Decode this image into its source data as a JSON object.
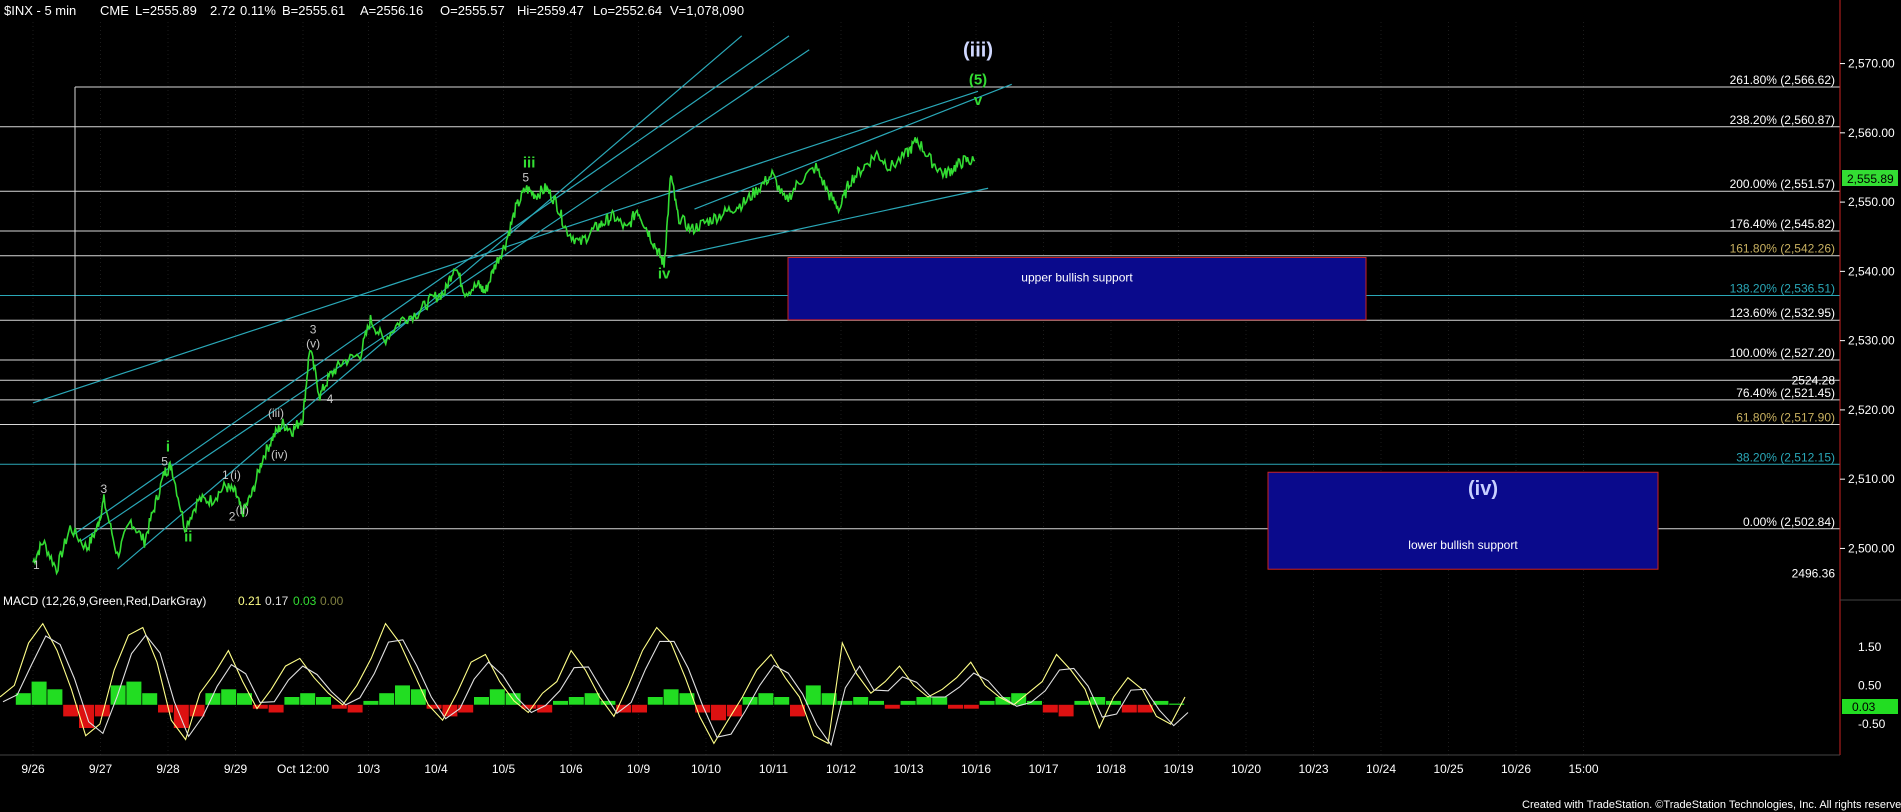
{
  "header": {
    "symbol": "$INX - 5 min",
    "exchange": "CME",
    "last": "L=2555.89",
    "change": "2.72",
    "change_pct": "0.11%",
    "bid": "B=2555.61",
    "ask": "A=2556.16",
    "open": "O=2555.57",
    "high": "Hi=2559.47",
    "low": "Lo=2552.64",
    "volume": "V=1,078,090"
  },
  "macd_header": {
    "label": "MACD (12,26,9,Green,Red,DarkGray)",
    "v1": "0.21",
    "v2": "0.17",
    "v3": "0.03",
    "v4": "0.00"
  },
  "footer": "Created with TradeStation. ©TradeStation Technologies, Inc. All rights reserved.",
  "price_axis_labels": [
    "2,570.00",
    "2,560.00",
    "2,550.00",
    "2,540.00",
    "2,530.00",
    "2,520.00",
    "2,510.00",
    "2,500.00"
  ],
  "current_price_label": "2,555.89",
  "macd_axis_labels": [
    "1.50",
    "0.50",
    "-0.50"
  ],
  "macd_current_label": "0.03",
  "colors": {
    "price": "#33dd33",
    "channel": "#2aa8b8",
    "fib_line": "#d8d8d8",
    "zone_fill": "#0a0a8c",
    "zone_border": "#cc2222",
    "macd_pos": "#22dd22",
    "macd_neg": "#dd1111",
    "macd_line": "#ffff88",
    "macd_signal": "#e0e0e0"
  },
  "chart_data": {
    "type": "line",
    "title": "$INX - 5 min",
    "x_tick_labels": [
      "9/26",
      "9/27",
      "9/28",
      "9/29",
      "Oct 12:00",
      "10/3",
      "10/4",
      "10/5",
      "10/6",
      "10/9",
      "10/10",
      "10/11",
      "10/12",
      "10/13",
      "10/16",
      "10/17",
      "10/18",
      "10/19",
      "10/20",
      "10/23",
      "10/24",
      "10/25",
      "10/26",
      "15:00"
    ],
    "ylim": [
      2494,
      2576
    ],
    "y_ticks": [
      2500,
      2510,
      2520,
      2530,
      2540,
      2550,
      2560,
      2570
    ],
    "series": [
      {
        "values": [
          [
            0,
            2498
          ],
          [
            0.15,
            2501
          ],
          [
            0.35,
            2497
          ],
          [
            0.55,
            2503
          ],
          [
            0.8,
            2500
          ],
          [
            0.95,
            2503
          ],
          [
            1.05,
            2507
          ],
          [
            1.25,
            2499
          ],
          [
            1.45,
            2504
          ],
          [
            1.65,
            2501
          ],
          [
            1.8,
            2506
          ],
          [
            1.95,
            2511
          ],
          [
            2.05,
            2512
          ],
          [
            2.25,
            2503
          ],
          [
            2.45,
            2507
          ],
          [
            2.65,
            2507
          ],
          [
            2.85,
            2509
          ],
          [
            3.0,
            2508
          ],
          [
            3.1,
            2505
          ],
          [
            3.25,
            2508
          ],
          [
            3.4,
            2513
          ],
          [
            3.55,
            2516
          ],
          [
            3.7,
            2518
          ],
          [
            3.85,
            2517
          ],
          [
            4.0,
            2519
          ],
          [
            4.1,
            2529
          ],
          [
            4.25,
            2522
          ],
          [
            4.4,
            2525
          ],
          [
            4.6,
            2527
          ],
          [
            4.85,
            2528
          ],
          [
            5.0,
            2533
          ],
          [
            5.2,
            2530
          ],
          [
            5.45,
            2533
          ],
          [
            5.7,
            2534
          ],
          [
            5.9,
            2536
          ],
          [
            6.1,
            2537
          ],
          [
            6.25,
            2541
          ],
          [
            6.4,
            2537
          ],
          [
            6.6,
            2538
          ],
          [
            6.7,
            2537
          ],
          [
            6.85,
            2541
          ],
          [
            7.0,
            2544
          ],
          [
            7.15,
            2549
          ],
          [
            7.3,
            2552
          ],
          [
            7.45,
            2551
          ],
          [
            7.6,
            2552
          ],
          [
            7.75,
            2550
          ],
          [
            7.9,
            2546
          ],
          [
            8.1,
            2544
          ],
          [
            8.3,
            2546
          ],
          [
            8.45,
            2547
          ],
          [
            8.6,
            2548
          ],
          [
            8.8,
            2546
          ],
          [
            8.95,
            2549
          ],
          [
            9.1,
            2546
          ],
          [
            9.25,
            2543
          ],
          [
            9.35,
            2541
          ],
          [
            9.45,
            2554
          ],
          [
            9.55,
            2548
          ],
          [
            9.75,
            2546
          ],
          [
            9.95,
            2547
          ],
          [
            10.15,
            2548
          ],
          [
            10.35,
            2549
          ],
          [
            10.55,
            2550
          ],
          [
            10.75,
            2552
          ],
          [
            10.95,
            2554
          ],
          [
            11.15,
            2550
          ],
          [
            11.35,
            2553
          ],
          [
            11.6,
            2555
          ],
          [
            11.8,
            2551
          ],
          [
            11.95,
            2549
          ],
          [
            12.1,
            2553
          ],
          [
            12.3,
            2555
          ],
          [
            12.5,
            2557
          ],
          [
            12.7,
            2555
          ],
          [
            12.95,
            2557
          ],
          [
            13.1,
            2559
          ],
          [
            13.3,
            2556
          ],
          [
            13.5,
            2554
          ],
          [
            13.65,
            2555
          ],
          [
            13.8,
            2556
          ],
          [
            13.95,
            2555.9
          ]
        ]
      }
    ],
    "fib_levels": [
      {
        "label": "261.80% (2,566.62)",
        "value": 2566.62,
        "color": "#ffffff"
      },
      {
        "label": "238.20% (2,560.87)",
        "value": 2560.87,
        "color": "#ffffff"
      },
      {
        "label": "200.00% (2,551.57)",
        "value": 2551.57,
        "color": "#ffffff"
      },
      {
        "label": "176.40% (2,545.82)",
        "value": 2545.82,
        "color": "#ffffff"
      },
      {
        "label": "161.80% (2,542.26)",
        "value": 2542.26,
        "color": "#c8b060"
      },
      {
        "label": "138.20% (2,536.51)",
        "value": 2536.51,
        "color": "#2aa8b8"
      },
      {
        "label": "123.60% (2,532.95)",
        "value": 2532.95,
        "color": "#ffffff"
      },
      {
        "label": "100.00% (2,527.20)",
        "value": 2527.2,
        "color": "#ffffff"
      },
      {
        "label": "76.40% (2,521.45)",
        "value": 2521.45,
        "color": "#ffffff"
      },
      {
        "label": "61.80% (2,517.90)",
        "value": 2517.9,
        "color": "#c8b060"
      },
      {
        "label": "38.20% (2,512.15)",
        "value": 2512.15,
        "color": "#2aa8b8"
      },
      {
        "label": "0.00% (2,502.84)",
        "value": 2502.84,
        "color": "#ffffff"
      }
    ],
    "extra_levels": [
      {
        "label": "2524.28",
        "value": 2524.28
      },
      {
        "label": "2496.36",
        "value": 2496.36
      }
    ],
    "zones": [
      {
        "label": "upper bullish support",
        "x0": 9.25,
        "x1": 13.95,
        "y0": 2533,
        "y1": 2542
      },
      {
        "label": "lower bullish support",
        "x0": 13.95,
        "x1": 14.9,
        "y0": 2497,
        "y1": 2511
      },
      {
        "label": "(iv)",
        "x0": 13.95,
        "x1": 14.9,
        "y0": 2505,
        "y1": 2511
      }
    ],
    "wave_labels": [
      {
        "text": "1",
        "x": 0.05,
        "y": 2497,
        "style": "grey"
      },
      {
        "text": "3",
        "x": 1.05,
        "y": 2508,
        "style": "grey"
      },
      {
        "text": "5",
        "x": 1.95,
        "y": 2512,
        "style": "grey"
      },
      {
        "text": "i",
        "x": 2.0,
        "y": 2514,
        "style": "green"
      },
      {
        "text": "ii",
        "x": 2.3,
        "y": 2501,
        "style": "green"
      },
      {
        "text": "1",
        "x": 2.85,
        "y": 2510,
        "style": "grey"
      },
      {
        "text": "(i)",
        "x": 3.0,
        "y": 2510,
        "style": "grey"
      },
      {
        "text": "2",
        "x": 2.95,
        "y": 2504,
        "style": "grey"
      },
      {
        "text": "(ii)",
        "x": 3.1,
        "y": 2505,
        "style": "grey"
      },
      {
        "text": "(iii)",
        "x": 3.6,
        "y": 2519,
        "style": "grey"
      },
      {
        "text": "(iv)",
        "x": 3.65,
        "y": 2513,
        "style": "grey"
      },
      {
        "text": "3",
        "x": 4.15,
        "y": 2531,
        "style": "grey"
      },
      {
        "text": "(v)",
        "x": 4.15,
        "y": 2529,
        "style": "grey"
      },
      {
        "text": "4",
        "x": 4.4,
        "y": 2521,
        "style": "grey"
      },
      {
        "text": "5",
        "x": 7.3,
        "y": 2553,
        "style": "grey"
      },
      {
        "text": "iii",
        "x": 7.35,
        "y": 2555,
        "style": "green"
      },
      {
        "text": "iv",
        "x": 9.35,
        "y": 2539,
        "style": "green"
      },
      {
        "text": "v",
        "x": 14.0,
        "y": 2564,
        "style": "green"
      },
      {
        "text": "(5)",
        "x": 14.0,
        "y": 2567,
        "style": "green"
      },
      {
        "text": "(iii)",
        "x": 14.0,
        "y": 2571,
        "style": "big"
      }
    ],
    "trend_lines": [
      [
        [
          0.0,
          2521
        ],
        [
          14.0,
          2566
        ]
      ],
      [
        [
          0.6,
          2502
        ],
        [
          11.2,
          2574
        ]
      ],
      [
        [
          0.7,
          2501
        ],
        [
          11.5,
          2572
        ]
      ],
      [
        [
          1.25,
          2497
        ],
        [
          10.5,
          2574
        ]
      ],
      [
        [
          9.4,
          2542
        ],
        [
          14.15,
          2552
        ]
      ],
      [
        [
          9.8,
          2549
        ],
        [
          14.5,
          2567
        ]
      ]
    ],
    "macd": {
      "label": "MACD (12,26,9,Green,Red,DarkGray)",
      "ylim": [
        -1.3,
        2.4
      ],
      "y_ticks": [
        1.5,
        0.5,
        -0.5
      ],
      "values": [
        0.2,
        0.5,
        1.6,
        2.1,
        1.4,
        0.4,
        -0.8,
        -0.5,
        0.9,
        1.8,
        2.0,
        1.1,
        -0.4,
        -0.9,
        0.3,
        0.8,
        1.4,
        0.6,
        -0.1,
        0.4,
        1.0,
        1.2,
        0.7,
        0.3,
        0.0,
        0.5,
        1.2,
        2.1,
        1.6,
        0.8,
        0.0,
        -0.4,
        0.3,
        1.1,
        1.3,
        0.6,
        0.1,
        -0.2,
        0.3,
        0.6,
        1.4,
        0.9,
        0.2,
        -0.3,
        0.5,
        1.4,
        2.0,
        1.6,
        0.7,
        -0.3,
        -1.0,
        -0.4,
        0.2,
        0.9,
        1.3,
        0.7,
        0.2,
        -0.8,
        -1.0,
        1.6,
        0.8,
        0.3,
        0.6,
        1.0,
        0.5,
        0.2,
        0.4,
        0.7,
        1.1,
        0.5,
        0.2,
        0.0,
        0.3,
        0.6,
        1.3,
        0.9,
        0.4,
        -0.6,
        0.2,
        0.7,
        0.4,
        -0.3,
        -0.5,
        0.2
      ],
      "hist": [
        0.0,
        0.3,
        0.6,
        0.4,
        -0.3,
        -0.6,
        -0.3,
        0.5,
        0.6,
        0.3,
        -0.2,
        -0.6,
        -0.3,
        0.3,
        0.4,
        0.3,
        -0.1,
        -0.2,
        0.2,
        0.3,
        0.2,
        -0.1,
        -0.2,
        0.1,
        0.3,
        0.5,
        0.4,
        -0.1,
        -0.3,
        -0.2,
        0.2,
        0.4,
        0.3,
        -0.1,
        -0.2,
        0.1,
        0.2,
        0.3,
        0.1,
        -0.2,
        -0.2,
        0.2,
        0.4,
        0.3,
        -0.2,
        -0.4,
        -0.3,
        0.2,
        0.3,
        0.2,
        -0.3,
        0.5,
        0.3,
        0.1,
        0.2,
        0.1,
        -0.1,
        0.1,
        0.2,
        0.2,
        -0.1,
        -0.1,
        0.1,
        0.2,
        0.3,
        0.1,
        -0.2,
        -0.3,
        0.1,
        0.2,
        0.1,
        -0.2,
        -0.2,
        0.1,
        0.03
      ]
    }
  }
}
